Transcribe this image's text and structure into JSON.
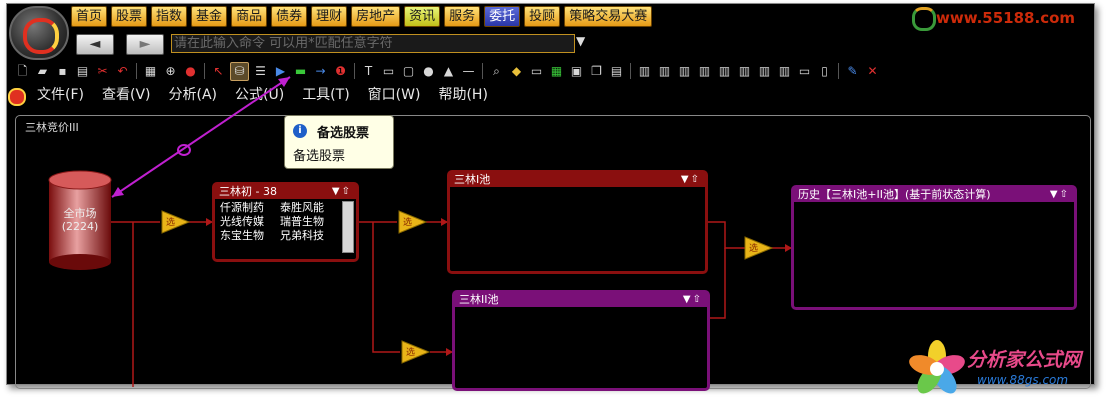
{
  "nav": {
    "items": [
      {
        "label": "首页",
        "style": "normal"
      },
      {
        "label": "股票",
        "style": "normal"
      },
      {
        "label": "指数",
        "style": "normal"
      },
      {
        "label": "基金",
        "style": "normal"
      },
      {
        "label": "商品",
        "style": "normal"
      },
      {
        "label": "债券",
        "style": "normal"
      },
      {
        "label": "理财",
        "style": "normal"
      },
      {
        "label": "房地产",
        "style": "normal"
      },
      {
        "label": "资讯",
        "style": "green"
      },
      {
        "label": "服务",
        "style": "normal"
      },
      {
        "label": "委托",
        "style": "active"
      },
      {
        "label": "投顾",
        "style": "normal"
      },
      {
        "label": "策略交易大赛",
        "style": "normal"
      }
    ],
    "brand": "www.55188.com"
  },
  "commandbar": {
    "back_label": "◄",
    "forward_label": "►",
    "placeholder": "请在此输入命令  可以用*匹配任意字符",
    "dropdown": "▼"
  },
  "toolbar": {
    "icons": [
      "new-file-icon",
      "open-folder-icon",
      "save-icon",
      "print-icon",
      "cut-icon",
      "undo-icon",
      "sep",
      "grid-icon",
      "zoom-icon",
      "record-icon",
      "sep",
      "pointer-icon",
      "database-icon",
      "list-icon",
      "play-icon",
      "delete-icon",
      "arrow-right-icon",
      "badge-icon",
      "sep",
      "text-icon",
      "rectangle-icon",
      "rounded-rect-icon",
      "ellipse-icon",
      "triangle-icon",
      "line-icon",
      "sep",
      "magnifier-icon",
      "fill-icon",
      "window-icon",
      "table-icon",
      "align-icon",
      "copy-icon",
      "paste-icon",
      "sep",
      "align-left-icon",
      "align-center-icon",
      "align-right-icon",
      "align-top-icon",
      "align-middle-icon",
      "align-bottom-icon",
      "distribute-h-icon",
      "distribute-v-icon",
      "same-width-icon",
      "same-height-icon",
      "sep",
      "edit-icon",
      "close-icon"
    ],
    "selected": "database-icon"
  },
  "menubar": {
    "items": [
      "文件(F)",
      "查看(V)",
      "分析(A)",
      "公式(U)",
      "工具(T)",
      "窗口(W)",
      "帮助(H)"
    ]
  },
  "canvas": {
    "title": "三林竞价III"
  },
  "tooltip": {
    "title": "备选股票",
    "body": "备选股票"
  },
  "source": {
    "label": "全市场",
    "count": "(2224)"
  },
  "panels": {
    "initial": {
      "title": "三林初 - 38",
      "controls": "▼⇧",
      "stocks": [
        [
          "仟源制药",
          "泰胜风能"
        ],
        [
          "光线传媒",
          "瑞普生物"
        ],
        [
          "东宝生物",
          "兄弟科技"
        ]
      ]
    },
    "pool1": {
      "title": "三林I池",
      "controls": "▼⇧"
    },
    "pool2": {
      "title": "三林II池",
      "controls": "▼⇧"
    },
    "history": {
      "title": "历史【三林I池+II池】(基于前状态计算)",
      "controls": "▼⇧"
    }
  },
  "filters": {
    "label": "选"
  },
  "watermark": {
    "name": "分析家公式网",
    "url": "www.88gs.com"
  },
  "colors": {
    "nav_gold": "#f0b030",
    "panel_red": "#8a0f0f",
    "panel_purple": "#7a1078",
    "connector": "#b01818",
    "annotation": "#c020d0"
  }
}
